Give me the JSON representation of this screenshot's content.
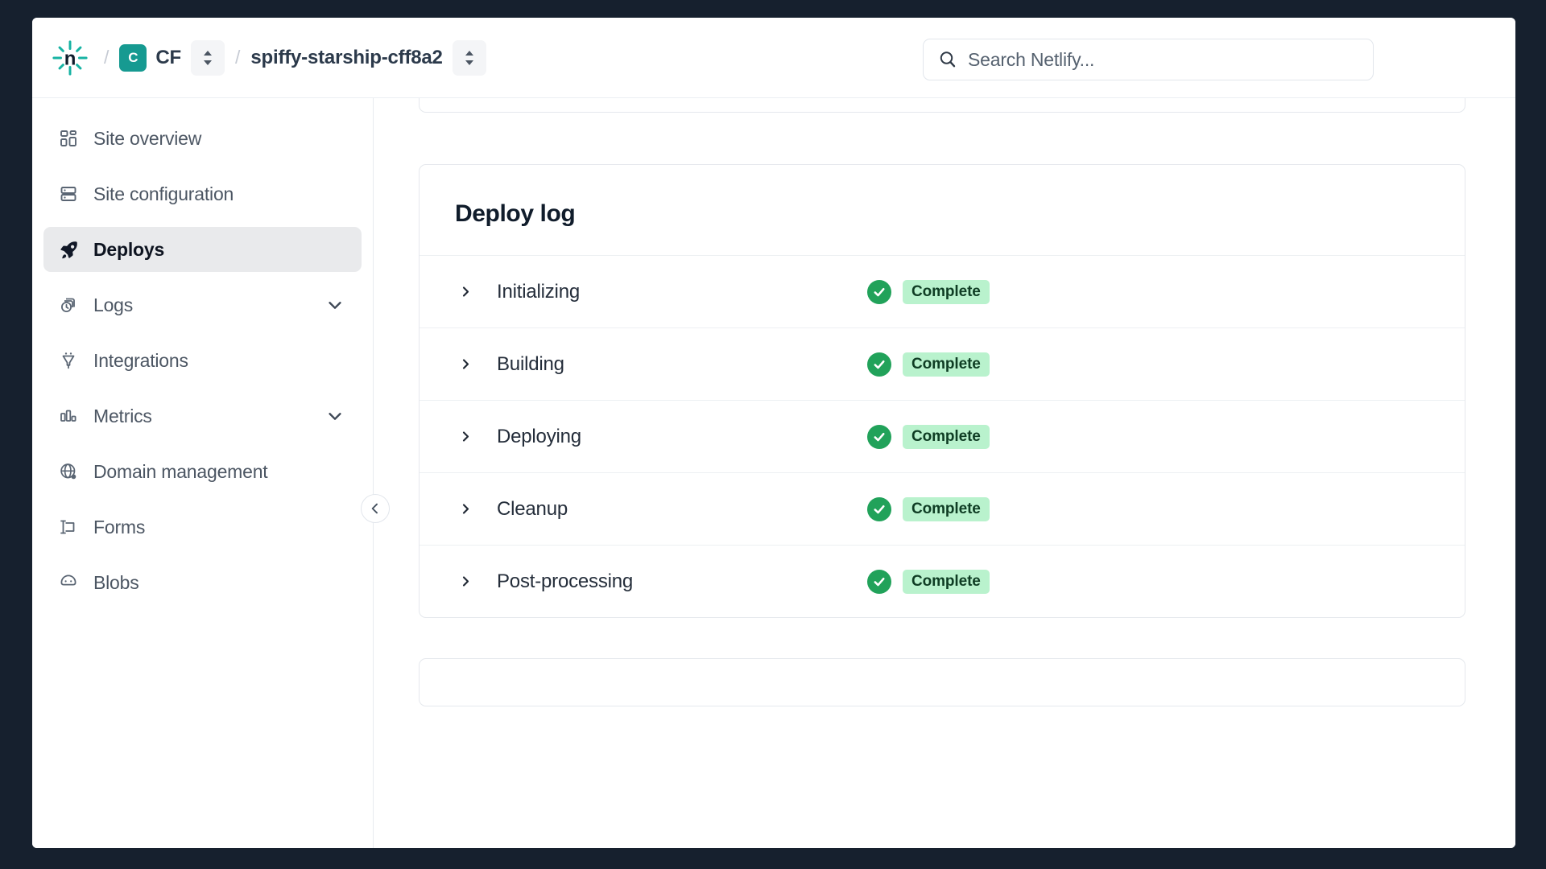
{
  "topbar": {
    "logo_icon": "netlify-logo-icon",
    "breadcrumb_separator": "/",
    "team": {
      "avatar_letter": "C",
      "name": "CF",
      "selector_icon": "chevron-up-down-icon"
    },
    "site": {
      "name": "spiffy-starship-cff8a2",
      "selector_icon": "chevron-up-down-icon"
    },
    "search": {
      "icon": "search-icon",
      "placeholder": "Search Netlify...",
      "value": ""
    }
  },
  "sidebar": {
    "collapse_button_icon": "chevron-left-icon",
    "items": [
      {
        "label": "Site overview",
        "icon": "grid-icon",
        "active": false,
        "expandable": false
      },
      {
        "label": "Site configuration",
        "icon": "server-icon",
        "active": false,
        "expandable": false
      },
      {
        "label": "Deploys",
        "icon": "rocket-icon",
        "active": true,
        "expandable": false
      },
      {
        "label": "Logs",
        "icon": "log-clock-icon",
        "active": false,
        "expandable": true
      },
      {
        "label": "Integrations",
        "icon": "plug-icon",
        "active": false,
        "expandable": false
      },
      {
        "label": "Metrics",
        "icon": "bar-chart-icon",
        "active": false,
        "expandable": true
      },
      {
        "label": "Domain management",
        "icon": "globe-icon",
        "active": false,
        "expandable": false
      },
      {
        "label": "Forms",
        "icon": "form-icon",
        "active": false,
        "expandable": false
      },
      {
        "label": "Blobs",
        "icon": "blob-icon",
        "active": false,
        "expandable": false
      }
    ]
  },
  "main": {
    "deploy_log": {
      "title": "Deploy log",
      "expand_icon": "chevron-right-icon",
      "status_icon": "check-circle-icon",
      "rows": [
        {
          "label": "Initializing",
          "status": "Complete"
        },
        {
          "label": "Building",
          "status": "Complete"
        },
        {
          "label": "Deploying",
          "status": "Complete"
        },
        {
          "label": "Cleanup",
          "status": "Complete"
        },
        {
          "label": "Post-processing",
          "status": "Complete"
        }
      ]
    }
  },
  "colors": {
    "frame": "#16202e",
    "brand_teal": "#169a91",
    "status_green": "#21a25a",
    "badge_bg": "#b9f2cd",
    "active_nav_bg": "#e9eaec"
  }
}
